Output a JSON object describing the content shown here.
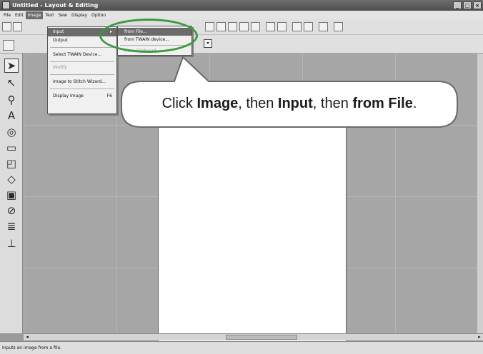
{
  "window": {
    "title": "Untitled - Layout & Editing"
  },
  "menubar": [
    "File",
    "Edit",
    "Image",
    "Text",
    "Sew",
    "Display",
    "Option"
  ],
  "image_menu": {
    "items": [
      {
        "label": "Input",
        "has_submenu": true
      },
      {
        "label": "Output"
      },
      {
        "label": "Select TWAIN Device..."
      },
      {
        "label": "Modify"
      },
      {
        "label": "Image to Stitch Wizard..."
      },
      {
        "label": "Display Image",
        "shortcut": "F6"
      }
    ]
  },
  "input_submenu": {
    "items": [
      {
        "label": "from File..."
      },
      {
        "label": "from TWAIN device..."
      },
      {
        "label": "from Clipboard"
      }
    ]
  },
  "callout": {
    "t1": "Click ",
    "b1": "Image",
    "t2": ", then ",
    "b2": "Input",
    "t3": ", then ",
    "b3": "from File",
    "t4": "."
  },
  "status": {
    "text": "Inputs an image from a file."
  },
  "icons": {
    "window_controls": [
      "minimize-icon",
      "maximize-icon",
      "close-icon"
    ],
    "tools": [
      "select-arrow-icon",
      "point-edit-icon",
      "zoom-icon",
      "text-icon",
      "circle-icon",
      "rectangle-icon",
      "outline-icon",
      "shape-icon",
      "fill-icon",
      "stitch-icon",
      "ruler-icon",
      "stamp-icon"
    ]
  },
  "colors": {
    "highlight_ring": "#3a9a3c",
    "menu_highlight": "#6b6b6b"
  }
}
